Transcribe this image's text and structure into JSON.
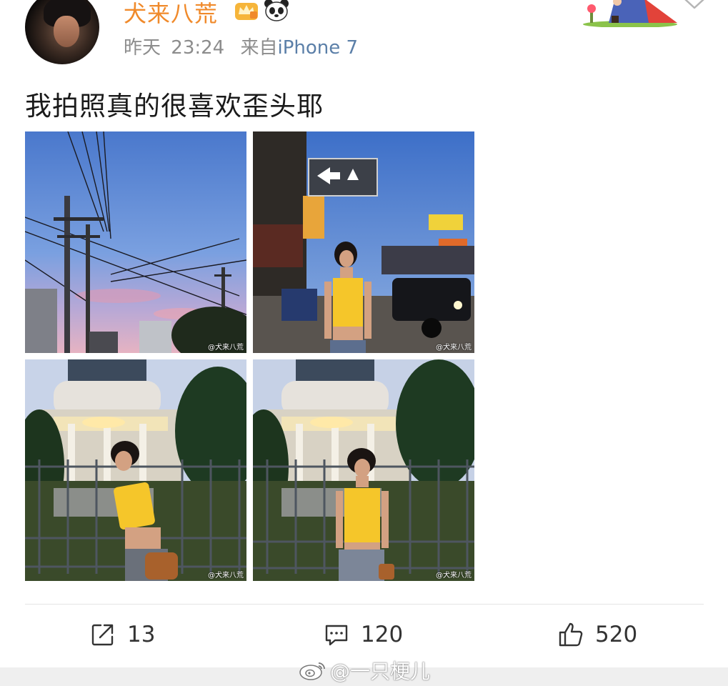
{
  "post": {
    "username": "犬来八荒",
    "time_label": "昨天",
    "time": "23:24",
    "from_label": "来自",
    "device": "iPhone 7",
    "text": "我拍照真的很喜欢歪头耶",
    "photo_watermark": "@犬来八荒",
    "icons": {
      "badge": "crown-icon",
      "emoji": "panda-icon",
      "menu": "chevron-down-icon"
    }
  },
  "actions": {
    "share_count": "13",
    "comment_count": "120",
    "like_count": "520"
  },
  "watermark": "@一只梗儿",
  "colors": {
    "username": "#f08a2b",
    "device_link": "#5b7fa8",
    "meta": "#8c8c8c"
  }
}
